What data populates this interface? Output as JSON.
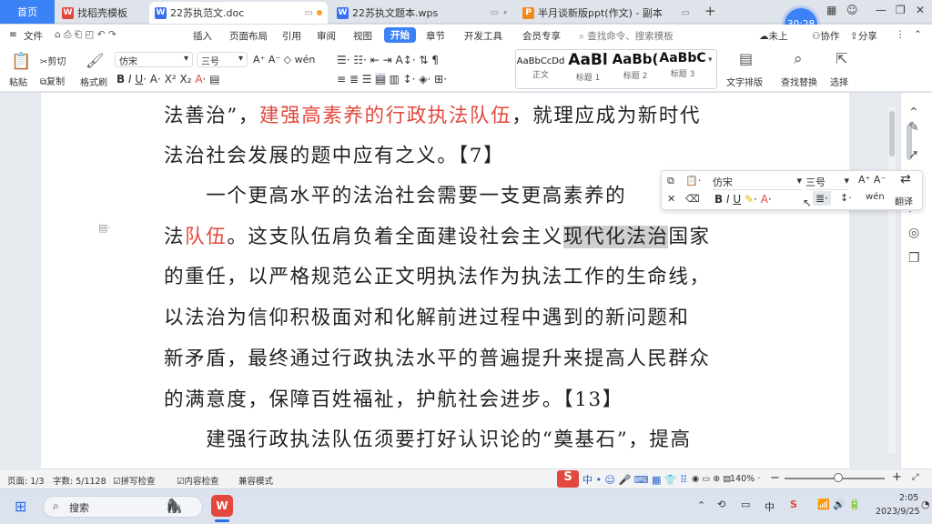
{
  "tabs": [
    {
      "label": "首页",
      "type": "home"
    },
    {
      "label": "找稻壳模板",
      "icon": "W",
      "color": "red"
    },
    {
      "label": "22苏执范文.doc",
      "icon": "W",
      "color": "blue",
      "active": true
    },
    {
      "label": "22苏执文题本.wps",
      "icon": "W",
      "color": "blue"
    },
    {
      "label": "半月谈新版ppt(作文) - 副本",
      "icon": "P",
      "color": "orange"
    }
  ],
  "tab_new": "+",
  "clock_bubble": "30:28",
  "menu": {
    "file": "文件",
    "items": [
      "插入",
      "页面布局",
      "引用",
      "审阅",
      "视图",
      "开始",
      "章节",
      "开发工具",
      "会员专享"
    ],
    "active": "开始",
    "search_placeholder": "查找命令、搜索模板",
    "unsync": "未上",
    "collab": "协作",
    "share": "分享"
  },
  "ribbon": {
    "paste": "粘贴",
    "cut": "剪切",
    "copy": "复制",
    "format_painter": "格式刷",
    "font_name": "仿宋",
    "font_size": "三号",
    "styles": [
      {
        "preview": "AaBbCcDd",
        "label": "正文"
      },
      {
        "preview": "AaBl",
        "label": "标题 1"
      },
      {
        "preview": "AaBb(",
        "label": "标题 2"
      },
      {
        "preview": "AaBbC",
        "label": "标题 3"
      }
    ],
    "text_layout": "文字排版",
    "find_replace": "查找替换",
    "select": "选择"
  },
  "document": {
    "lines": [
      {
        "segments": [
          {
            "text": "法善治”，"
          },
          {
            "text": "建强高素养的行政执法队伍",
            "red": true
          },
          {
            "text": "，就理应成为新时代"
          }
        ]
      },
      {
        "segments": [
          {
            "text": "法治社会发展的题中应有之义。【7】"
          }
        ]
      },
      {
        "segments": [
          {
            "text": "　　一个更高水平的法治社会需要一支更高素养的"
          }
        ]
      },
      {
        "segments": [
          {
            "text": "法"
          },
          {
            "text": "队伍",
            "red": true
          },
          {
            "text": "。这支队伍肩负着全面建设社会主义"
          },
          {
            "text": "现代化法治",
            "highlight": true
          },
          {
            "text": "国家"
          }
        ]
      },
      {
        "segments": [
          {
            "text": "的重任，以严格规范公正文明执法作为执法工作的生命线，"
          }
        ]
      },
      {
        "segments": [
          {
            "text": "以法治为信仰积极面对和化解前进过程中遇到的新问题和"
          }
        ]
      },
      {
        "segments": [
          {
            "text": "新矛盾，最终通过行政执法水平的普遍提升来提高人民群众"
          }
        ]
      },
      {
        "segments": [
          {
            "text": "的满意度，保障百姓福祉，护航社会进步。【13】"
          }
        ]
      },
      {
        "segments": [
          {
            "text": "　　建强行政执法队伍须要打好认识论的“奠基石”，提高"
          }
        ]
      }
    ]
  },
  "float_toolbar": {
    "font_name": "仿宋",
    "font_size": "三号",
    "translate": "翻译"
  },
  "status": {
    "page": "页面: 1/3",
    "words": "字数: 5/1128",
    "spell": "拼写检查",
    "content_check": "内容检查",
    "compat": "兼容模式",
    "zoom": "140%"
  },
  "taskbar": {
    "search": "搜索",
    "time": "2:05",
    "date": "2023/9/25",
    "ime": "中"
  },
  "colors": {
    "accent": "#3b82f6",
    "red_text": "#e2483d",
    "wps_red": "#e2483d"
  }
}
